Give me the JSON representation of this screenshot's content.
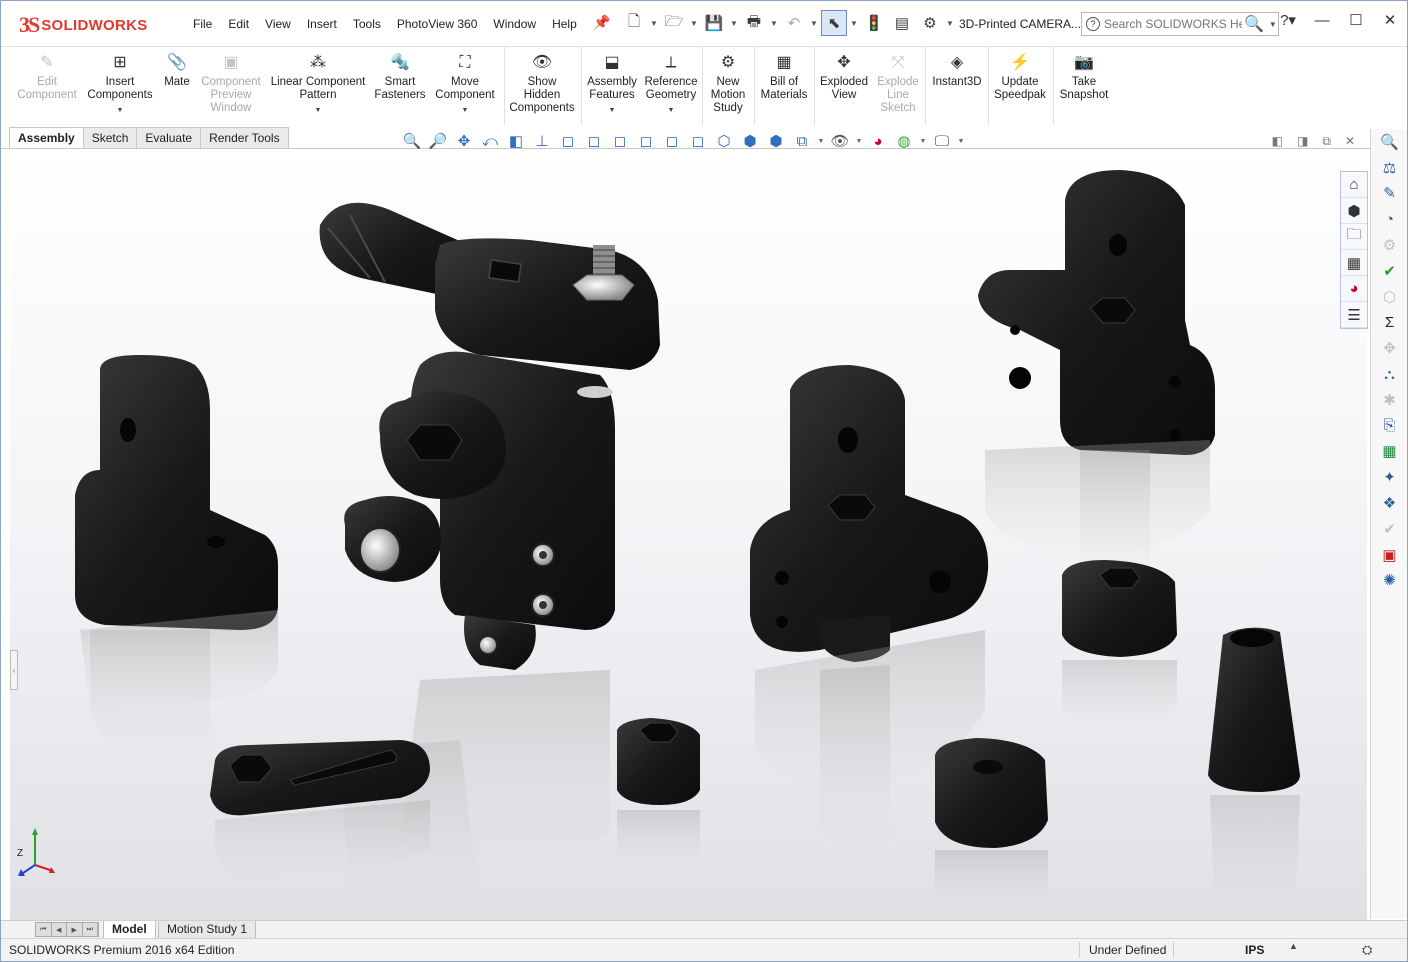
{
  "app": {
    "brand_prefix": "3S",
    "brand": "SOLIDWORKS",
    "document_title": "3D-Printed CAMERA..."
  },
  "menu": [
    "File",
    "Edit",
    "View",
    "Insert",
    "Tools",
    "PhotoView 360",
    "Window",
    "Help"
  ],
  "search": {
    "placeholder": "Search SOLIDWORKS Help"
  },
  "ribbon": {
    "buttons": [
      {
        "label": "Edit\nComponent",
        "icon": "edit-component-icon",
        "enabled": false
      },
      {
        "label": "Insert\nComponents",
        "icon": "insert-components-icon",
        "enabled": true
      },
      {
        "label": "Mate",
        "icon": "paperclip-icon",
        "enabled": true
      },
      {
        "label": "Component\nPreview\nWindow",
        "icon": "preview-window-icon",
        "enabled": false
      },
      {
        "label": "Linear Component\nPattern",
        "icon": "linear-pattern-icon",
        "enabled": true
      },
      {
        "label": "Smart\nFasteners",
        "icon": "fastener-icon",
        "enabled": true
      },
      {
        "label": "Move\nComponent",
        "icon": "move-component-icon",
        "enabled": true
      },
      {
        "label": "Show\nHidden\nComponents",
        "icon": "show-hidden-icon",
        "enabled": true
      },
      {
        "label": "Assembly\nFeatures",
        "icon": "assembly-features-icon",
        "enabled": true
      },
      {
        "label": "Reference\nGeometry",
        "icon": "reference-geometry-icon",
        "enabled": true
      },
      {
        "label": "New\nMotion\nStudy",
        "icon": "motion-study-icon",
        "enabled": true
      },
      {
        "label": "Bill of\nMaterials",
        "icon": "bom-icon",
        "enabled": true
      },
      {
        "label": "Exploded\nView",
        "icon": "exploded-view-icon",
        "enabled": true
      },
      {
        "label": "Explode\nLine\nSketch",
        "icon": "explode-line-icon",
        "enabled": false
      },
      {
        "label": "Instant3D",
        "icon": "instant3d-icon",
        "enabled": true
      },
      {
        "label": "Update\nSpeedpak",
        "icon": "speedpak-icon",
        "enabled": true
      },
      {
        "label": "Take\nSnapshot",
        "icon": "camera-icon",
        "enabled": true
      }
    ]
  },
  "command_tabs": [
    "Assembly",
    "Sketch",
    "Evaluate",
    "Render Tools"
  ],
  "bottom_tabs": [
    "Model",
    "Motion Study 1"
  ],
  "status": {
    "edition": "SOLIDWORKS Premium 2016 x64 Edition",
    "definition": "Under Defined",
    "units": "IPS"
  },
  "triad": {
    "z": "Z",
    "x": "X",
    "y": "Y"
  },
  "colors": {
    "brand": "#e03a2e",
    "part": "#1b1b1b",
    "background_top": "#ffffff",
    "background_bottom": "#dfe1e5"
  }
}
